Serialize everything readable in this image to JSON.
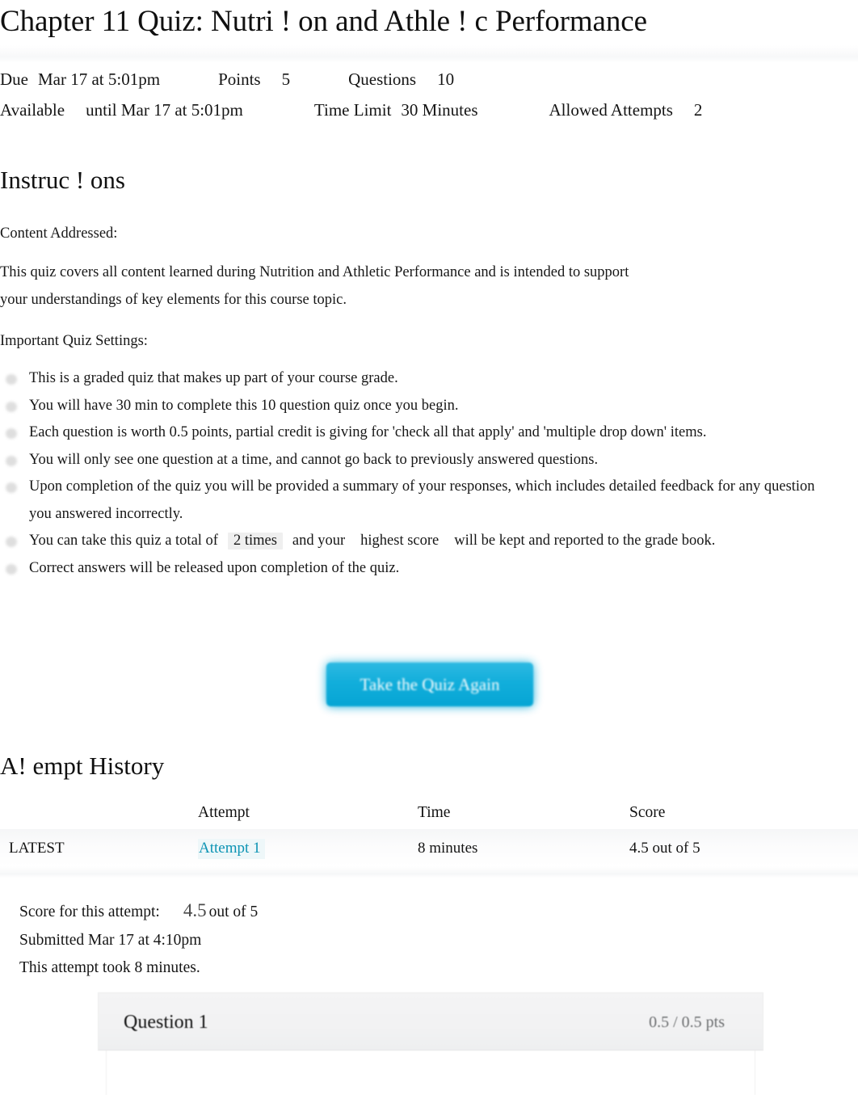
{
  "page": {
    "title": "Chapter 11 Quiz: Nutri  ! on and Athle  ! c Performance"
  },
  "meta": {
    "due_label": "Due",
    "due_value": "Mar 17 at 5:01pm",
    "points_label": "Points",
    "points_value": "5",
    "questions_label": "Questions",
    "questions_value": "10",
    "available_label": "Available",
    "available_value": "until Mar 17 at 5:01pm",
    "time_limit_label": "Time Limit",
    "time_limit_value": "30 Minutes",
    "allowed_attempts_label": "Allowed Attempts",
    "allowed_attempts_value": "2"
  },
  "instructions": {
    "heading": "Instruc ! ons",
    "content_addressed_label": "Content Addressed:",
    "description_line1": "This quiz covers all content learned during Nutrition and Athletic Performance and is intended to support",
    "description_line2": "your understandings of key elements for this course topic.",
    "settings_label": "Important Quiz Settings:",
    "bullets": [
      {
        "text": "This is a graded quiz that makes up part of your course grade."
      },
      {
        "text": "You will have 30 min to complete this 10 question quiz once you begin."
      },
      {
        "text": "Each question is worth 0.5 points, partial credit is giving for 'check all that apply' and 'multiple drop down' items."
      },
      {
        "text": "You will only see one question at a time, and cannot go back to previously answered questions."
      },
      {
        "text": "Upon completion of the quiz you will be provided a summary of your responses, which includes detailed feedback for any question you answered incorrectly."
      },
      {
        "prefix": "You can take this quiz a total of",
        "highlight1": "2 times",
        "middle": "and your",
        "highlight2": "highest score",
        "suffix": "will be kept and reported to the grade book."
      },
      {
        "text": "Correct answers will be released upon completion of the quiz."
      }
    ]
  },
  "actions": {
    "take_quiz_again": "Take the Quiz Again"
  },
  "attempt_history": {
    "heading": "A! empt History",
    "columns": {
      "blank": "",
      "attempt": "Attempt",
      "time": "Time",
      "score": "Score"
    },
    "rows": [
      {
        "flag": "LATEST",
        "attempt": "Attempt 1",
        "time": "8 minutes",
        "score": "4.5 out of 5"
      }
    ]
  },
  "score_summary": {
    "score_label": "Score for this attempt:",
    "score_value": "4.5",
    "score_suffix": "out of 5",
    "submitted": "Submitted Mar 17 at 4:10pm",
    "duration": "This attempt took 8 minutes."
  },
  "question": {
    "title": "Question 1",
    "points": "0.5 / 0.5 pts"
  },
  "colors": {
    "link": "#0d94b4",
    "button": "#12aedb",
    "muted": "#6d6f71",
    "header_bg": "#f2f2f3"
  }
}
